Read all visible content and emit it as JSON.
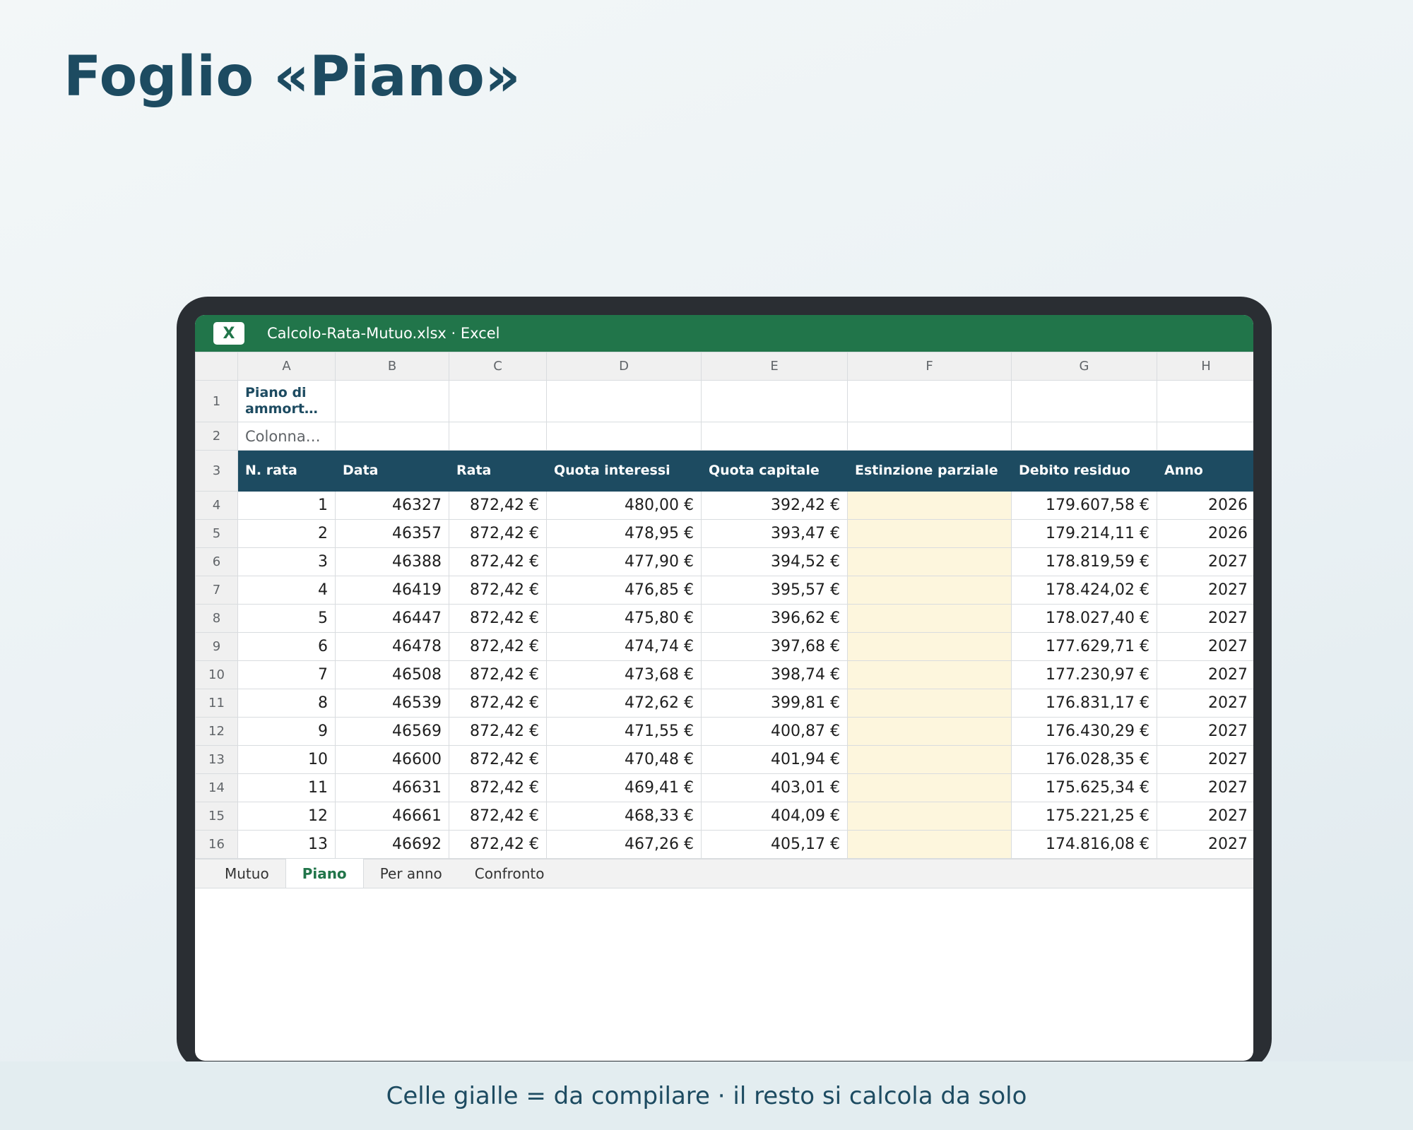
{
  "slide": {
    "title": "Foglio «Piano»",
    "caption": "Celle gialle = da compilare · il resto si calcola da solo"
  },
  "window": {
    "app_icon_label": "X",
    "title": "Calcolo-Rata-Mutuo.xlsx · Excel"
  },
  "columns": [
    "A",
    "B",
    "C",
    "D",
    "E",
    "F",
    "G",
    "H"
  ],
  "sheet": {
    "a1": "Piano di ammort…",
    "a2": "Colonna…",
    "headers": [
      "N. rata",
      "Data",
      "Rata",
      "Quota interessi",
      "Quota capitale",
      "Estinzione parziale",
      "Debito residuo",
      "Anno"
    ],
    "rows": [
      {
        "row": "4",
        "n": "1",
        "data": "46327",
        "rata": "872,42 €",
        "interessi": "480,00 €",
        "capitale": "392,42 €",
        "estinzione": "",
        "debito": "179.607,58 €",
        "anno": "2026"
      },
      {
        "row": "5",
        "n": "2",
        "data": "46357",
        "rata": "872,42 €",
        "interessi": "478,95 €",
        "capitale": "393,47 €",
        "estinzione": "",
        "debito": "179.214,11 €",
        "anno": "2026"
      },
      {
        "row": "6",
        "n": "3",
        "data": "46388",
        "rata": "872,42 €",
        "interessi": "477,90 €",
        "capitale": "394,52 €",
        "estinzione": "",
        "debito": "178.819,59 €",
        "anno": "2027"
      },
      {
        "row": "7",
        "n": "4",
        "data": "46419",
        "rata": "872,42 €",
        "interessi": "476,85 €",
        "capitale": "395,57 €",
        "estinzione": "",
        "debito": "178.424,02 €",
        "anno": "2027"
      },
      {
        "row": "8",
        "n": "5",
        "data": "46447",
        "rata": "872,42 €",
        "interessi": "475,80 €",
        "capitale": "396,62 €",
        "estinzione": "",
        "debito": "178.027,40 €",
        "anno": "2027"
      },
      {
        "row": "9",
        "n": "6",
        "data": "46478",
        "rata": "872,42 €",
        "interessi": "474,74 €",
        "capitale": "397,68 €",
        "estinzione": "",
        "debito": "177.629,71 €",
        "anno": "2027"
      },
      {
        "row": "10",
        "n": "7",
        "data": "46508",
        "rata": "872,42 €",
        "interessi": "473,68 €",
        "capitale": "398,74 €",
        "estinzione": "",
        "debito": "177.230,97 €",
        "anno": "2027"
      },
      {
        "row": "11",
        "n": "8",
        "data": "46539",
        "rata": "872,42 €",
        "interessi": "472,62 €",
        "capitale": "399,81 €",
        "estinzione": "",
        "debito": "176.831,17 €",
        "anno": "2027"
      },
      {
        "row": "12",
        "n": "9",
        "data": "46569",
        "rata": "872,42 €",
        "interessi": "471,55 €",
        "capitale": "400,87 €",
        "estinzione": "",
        "debito": "176.430,29 €",
        "anno": "2027"
      },
      {
        "row": "13",
        "n": "10",
        "data": "46600",
        "rata": "872,42 €",
        "interessi": "470,48 €",
        "capitale": "401,94 €",
        "estinzione": "",
        "debito": "176.028,35 €",
        "anno": "2027"
      },
      {
        "row": "14",
        "n": "11",
        "data": "46631",
        "rata": "872,42 €",
        "interessi": "469,41 €",
        "capitale": "403,01 €",
        "estinzione": "",
        "debito": "175.625,34 €",
        "anno": "2027"
      },
      {
        "row": "15",
        "n": "12",
        "data": "46661",
        "rata": "872,42 €",
        "interessi": "468,33 €",
        "capitale": "404,09 €",
        "estinzione": "",
        "debito": "175.221,25 €",
        "anno": "2027"
      },
      {
        "row": "16",
        "n": "13",
        "data": "46692",
        "rata": "872,42 €",
        "interessi": "467,26 €",
        "capitale": "405,17 €",
        "estinzione": "",
        "debito": "174.816,08 €",
        "anno": "2027"
      }
    ]
  },
  "tabs": [
    "Mutuo",
    "Piano",
    "Per anno",
    "Confronto"
  ],
  "active_tab": "Piano",
  "colors": {
    "excel_green": "#21754a",
    "header_fill": "#1d4b61",
    "input_yellow": "#fdf6dd",
    "device_frame": "#2a2e33"
  }
}
